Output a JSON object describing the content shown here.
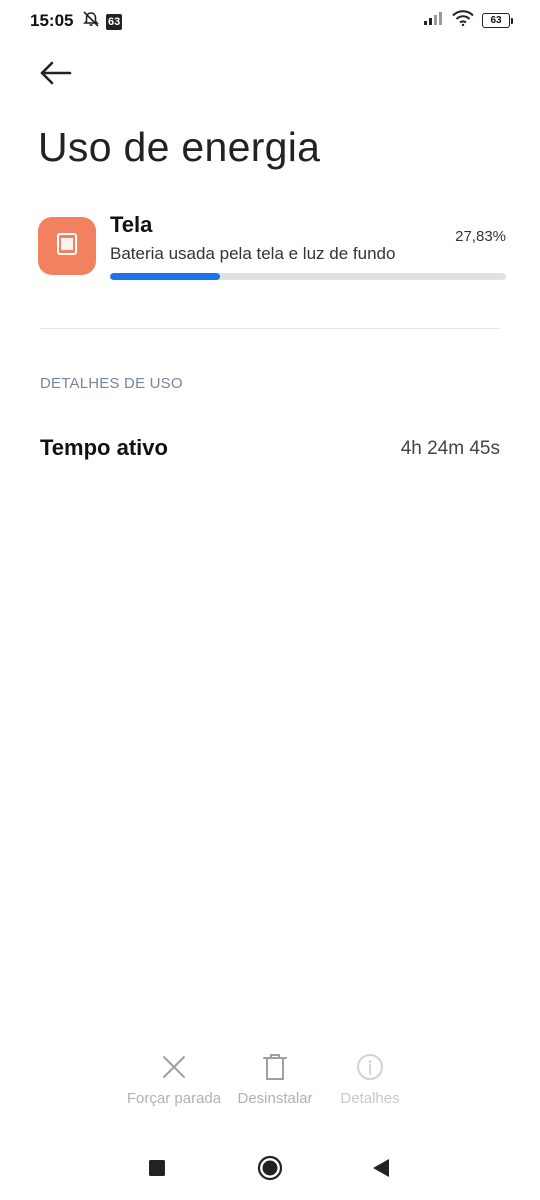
{
  "status_bar": {
    "time": "15:05",
    "notification_badge": "63",
    "battery_level": "63",
    "icons": [
      "alarm-off-icon",
      "signal-icon",
      "wifi-icon",
      "battery-icon"
    ]
  },
  "header": {
    "back_icon": "arrow-left-icon",
    "title": "Uso de energia"
  },
  "app": {
    "icon": "screen-icon",
    "icon_color": "#f2825f",
    "name": "Tela",
    "description": "Bateria usada pela tela e luz de fundo",
    "percent_label": "27,83%",
    "usage_fraction": 0.2783,
    "bar_color": "#1e74e8"
  },
  "details": {
    "section_title": "DETALHES DE USO",
    "rows": [
      {
        "label": "Tempo ativo",
        "value": "4h 24m 45s"
      }
    ]
  },
  "actions": [
    {
      "icon": "close-icon",
      "label": "Forçar parada"
    },
    {
      "icon": "trash-icon",
      "label": "Desinstalar"
    },
    {
      "icon": "info-icon",
      "label": "Detalhes"
    }
  ],
  "nav": [
    "recents-icon",
    "home-icon",
    "back-icon"
  ]
}
